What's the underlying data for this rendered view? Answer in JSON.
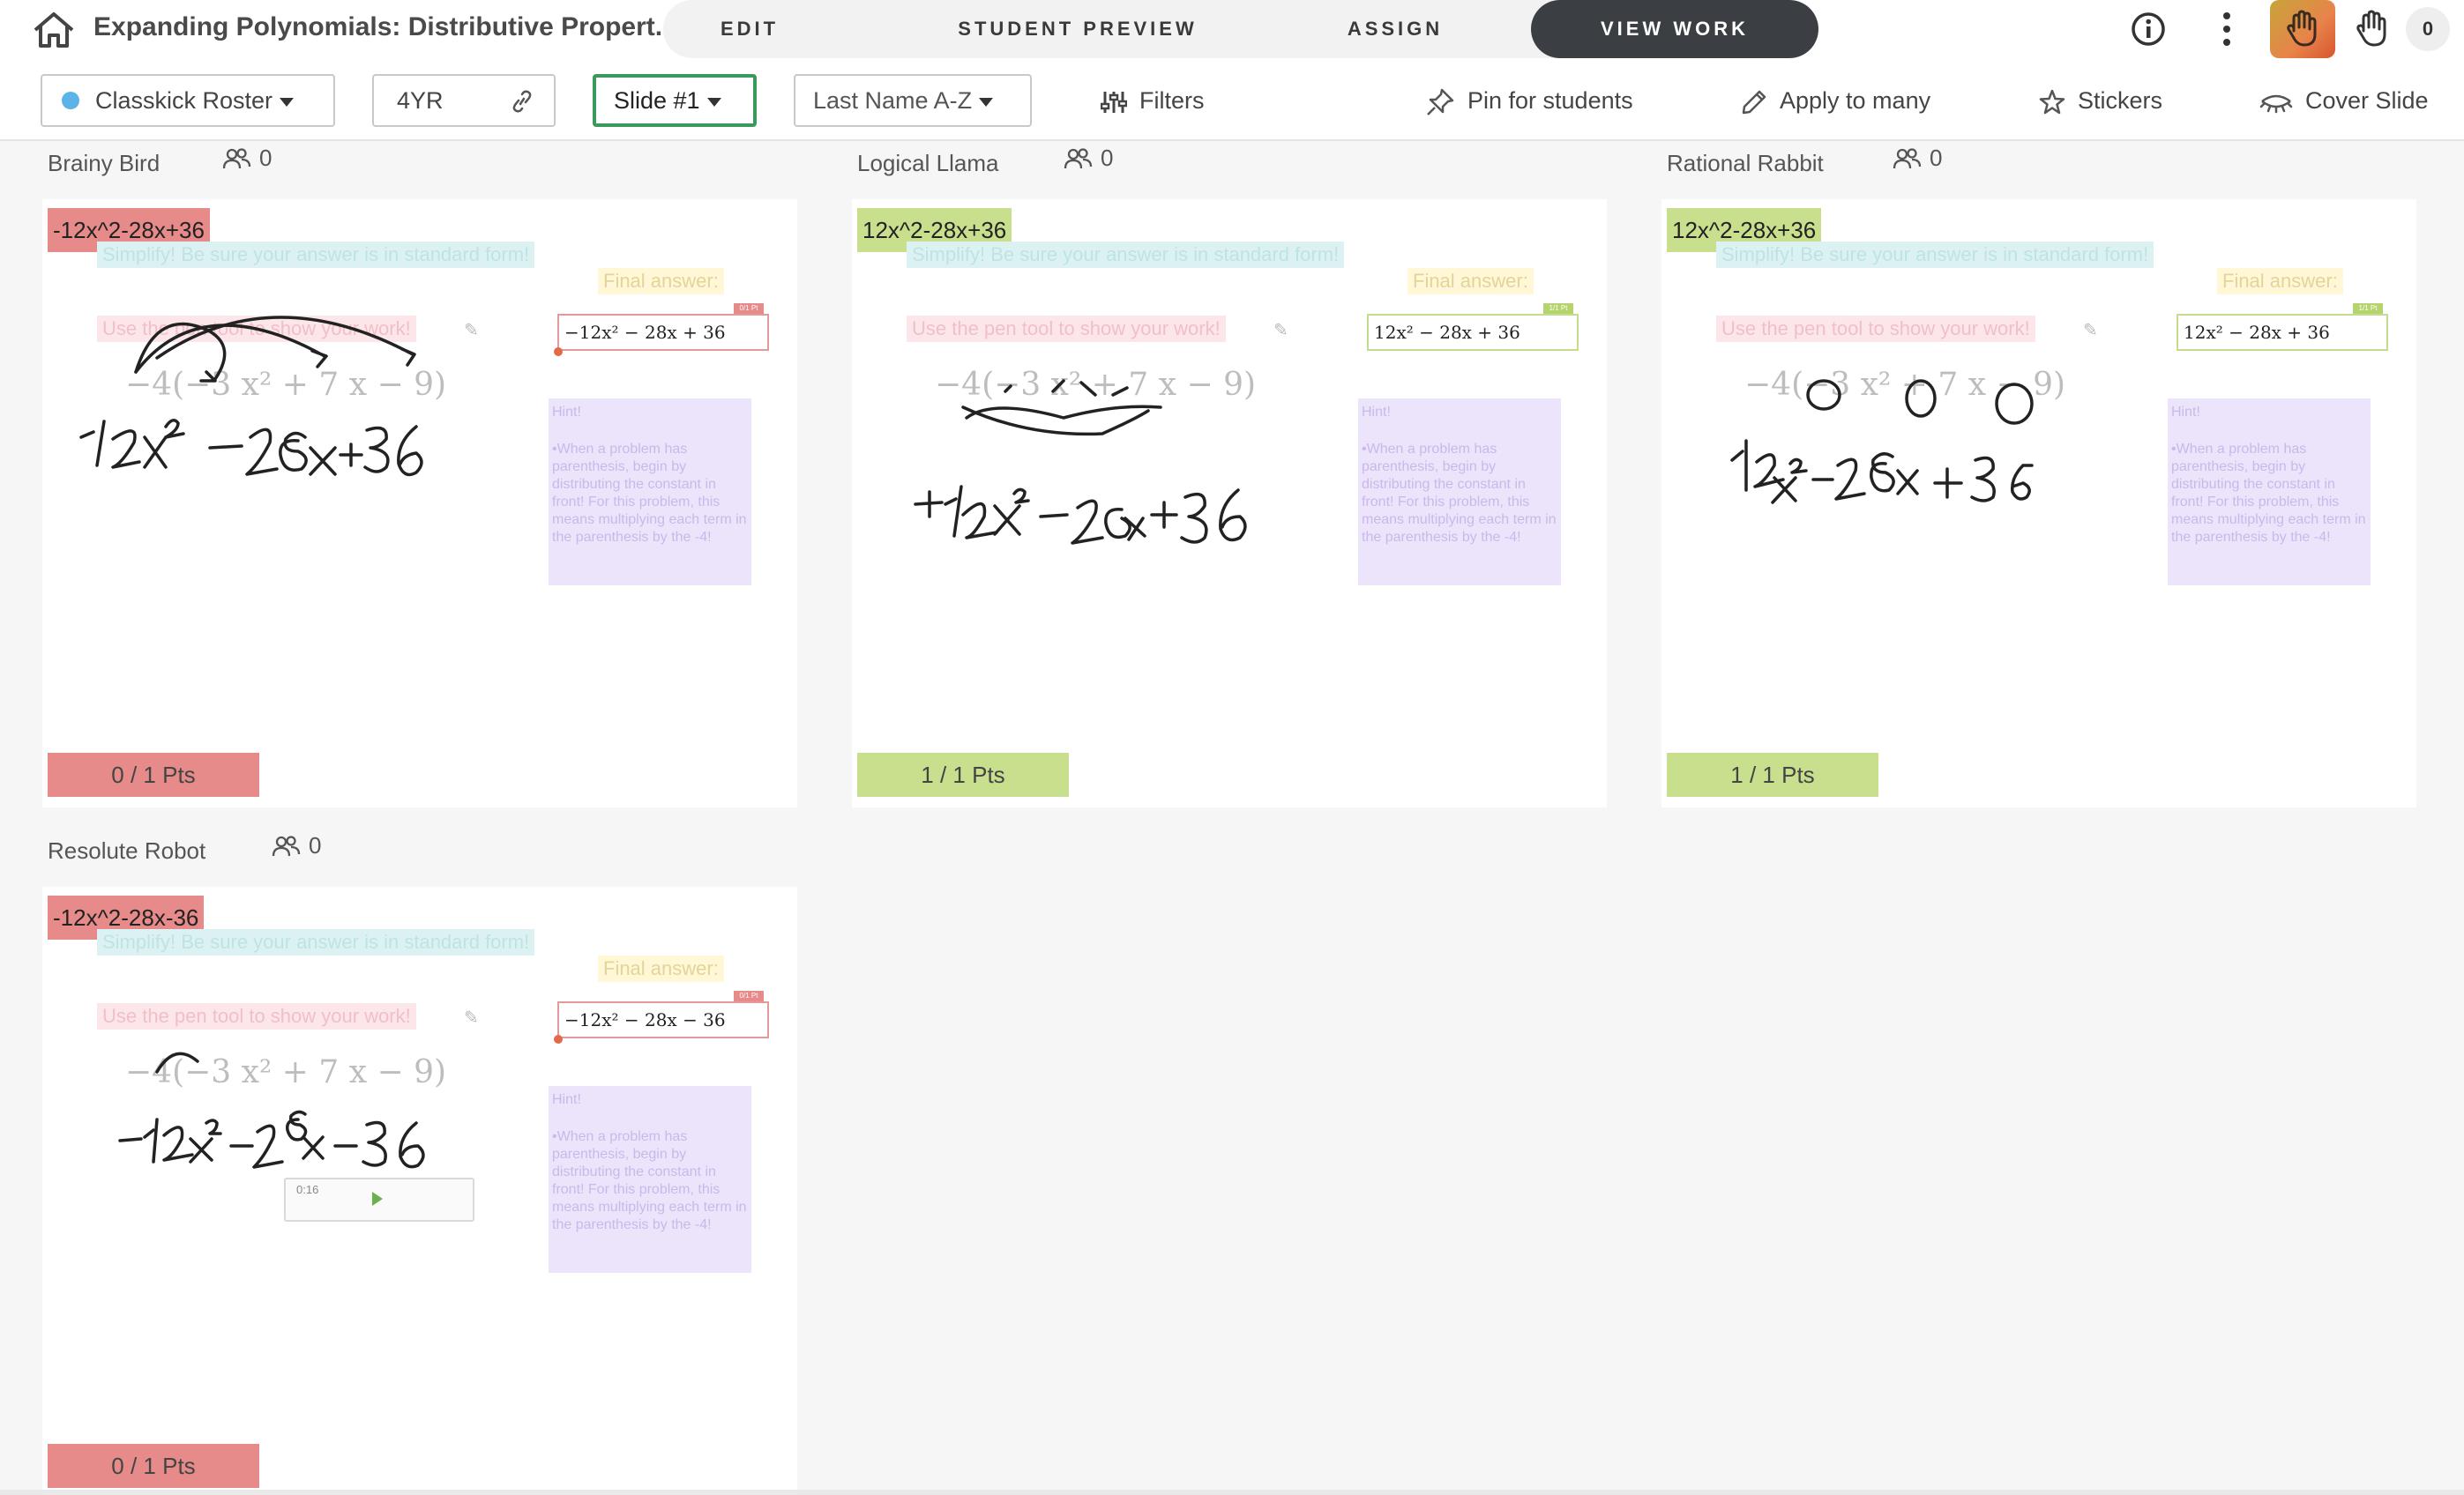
{
  "header": {
    "home_icon": "home-icon",
    "title": "Expanding Polynomials: Distributive Propert...",
    "tabs": [
      {
        "label": "EDIT",
        "active": false
      },
      {
        "label": "STUDENT PREVIEW",
        "active": false
      },
      {
        "label": "ASSIGN",
        "active": false
      },
      {
        "label": "VIEW WORK",
        "active": true
      }
    ],
    "info_icon": "info-icon",
    "more_icon": "more-vertical-icon",
    "raised_hand_icon": "hand-icon",
    "hand_count": "0"
  },
  "toolbar": {
    "roster": "Classkick Roster",
    "roster_dot_color": "#5bb3e8",
    "code": "4YR",
    "slide": "Slide #1",
    "sort": "Last Name A-Z",
    "filters": "Filters",
    "pin": "Pin for students",
    "apply": "Apply to many",
    "stickers": "Stickers",
    "cover": "Cover Slide"
  },
  "slide": {
    "instruction1": "Simplify!  Be sure your answer is in standard form!",
    "final_label": "Final answer:",
    "instruction2": "Use the pen tool to show your work!",
    "problem": "−4(−3 x² + 7 x − 9)",
    "hint_title": "Hint!",
    "hint_body": "•When a problem has parenthesis, begin by distributing the constant in front!  For this problem, this means multiplying each term in the parenthesis by the -4!"
  },
  "students": [
    {
      "name": "Brainy Bird",
      "views": "0",
      "answer_text": "-12x^2-28x+36",
      "status": "incorrect",
      "final_answer": "−12x² − 28x + 36",
      "pts_badge": "0/1 Pt",
      "score": "0 / 1 Pts"
    },
    {
      "name": "Logical Llama",
      "views": "0",
      "answer_text": "12x^2-28x+36",
      "status": "correct",
      "final_answer": "12x² − 28x + 36",
      "pts_badge": "1/1 Pt",
      "score": "1 / 1 Pts"
    },
    {
      "name": "Rational Rabbit",
      "views": "0",
      "answer_text": "12x^2-28x+36",
      "status": "correct",
      "final_answer": "12x² − 28x + 36",
      "pts_badge": "1/1 Pt",
      "score": "1 / 1 Pts"
    },
    {
      "name": "Resolute Robot",
      "views": "0",
      "answer_text": "-12x^2-28x-36",
      "status": "incorrect",
      "final_answer": "−12x² − 28x − 36",
      "pts_badge": "0/1 Pt",
      "score": "0 / 1 Pts",
      "audio_time": "0:16"
    }
  ],
  "colors": {
    "incorrect": "#e68a8a",
    "correct": "#c8df8e",
    "active_tab": "#3b3f44",
    "slide_outline": "#3a9a5b"
  }
}
